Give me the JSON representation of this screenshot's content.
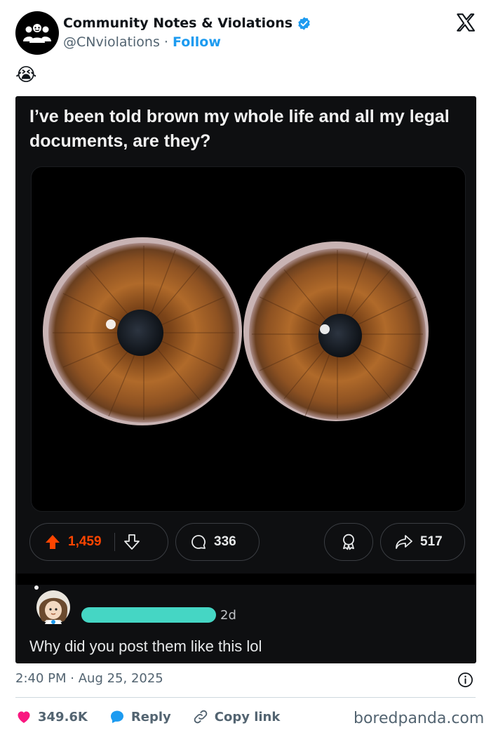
{
  "header": {
    "display_name": "Community Notes & Violations",
    "handle": "@CNviolations",
    "separator": "·",
    "follow_label": "Follow"
  },
  "tweet_emoji": "😭",
  "post": {
    "title": "I’ve been told brown my whole life and all my legal documents, are they?",
    "upvotes": "1,459",
    "comments": "336",
    "shares": "517",
    "comment": {
      "time": "2d",
      "text": "Why did you post them like this lol"
    }
  },
  "footer": {
    "time": "2:40 PM",
    "separator": "·",
    "date": "Aug 25, 2025",
    "likes": "349.6K",
    "reply_label": "Reply",
    "copy_label": "Copy link",
    "watermark": "boredpanda.com"
  },
  "colors": {
    "accent": "#1d9bf0",
    "like": "#f91880",
    "upvote": "#ff4500",
    "redacted_username": "#45d6c4"
  },
  "icons": [
    "verified-badge-icon",
    "x-logo-icon",
    "upvote-icon",
    "downvote-icon",
    "comment-icon",
    "award-icon",
    "share-icon",
    "info-icon",
    "heart-icon",
    "reply-icon",
    "link-icon"
  ]
}
